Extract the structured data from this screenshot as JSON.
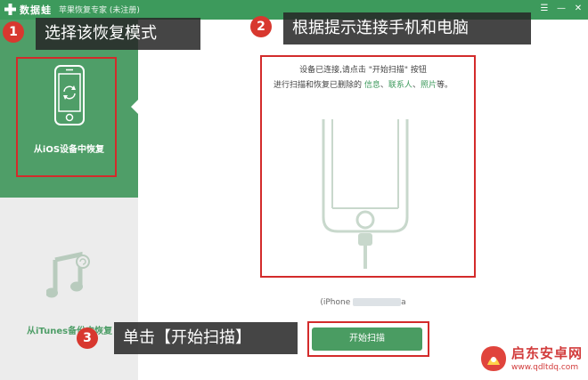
{
  "titlebar": {
    "app_title": "数据蛙",
    "app_subtitle": "苹果恢复专家 (未注册)",
    "buttons": [
      "☰",
      "—",
      "✕"
    ]
  },
  "sidebar": {
    "items": [
      {
        "label": "从iOS设备中恢复",
        "selected": true
      },
      {
        "label": "从iTunes备份中恢复",
        "selected": false
      }
    ]
  },
  "main": {
    "instruction_line1": "设备已连接,请点击 \"开始扫描\" 按钮",
    "instruction_line2_prefix": "进行扫描和恢复已删除的 ",
    "instruction_items": [
      "信息",
      "联系人",
      "照片"
    ],
    "instruction_sep": "、",
    "instruction_suffix": "等。",
    "device_name_prefix": "iPhone",
    "device_name_suffix": "a",
    "scan_button": "开始扫描"
  },
  "annotations": [
    {
      "number": "1",
      "text": "选择该恢复模式"
    },
    {
      "number": "2",
      "text": "根据提示连接手机和电脑"
    },
    {
      "number": "3",
      "text": "单击【开始扫描】"
    }
  ],
  "watermark": {
    "name": "启东安卓网",
    "url": "www.qdltdq.com"
  },
  "colors": {
    "brand_green": "#4f9e68",
    "title_green": "#3d9a5c",
    "annotation_red": "#d32b2b"
  }
}
